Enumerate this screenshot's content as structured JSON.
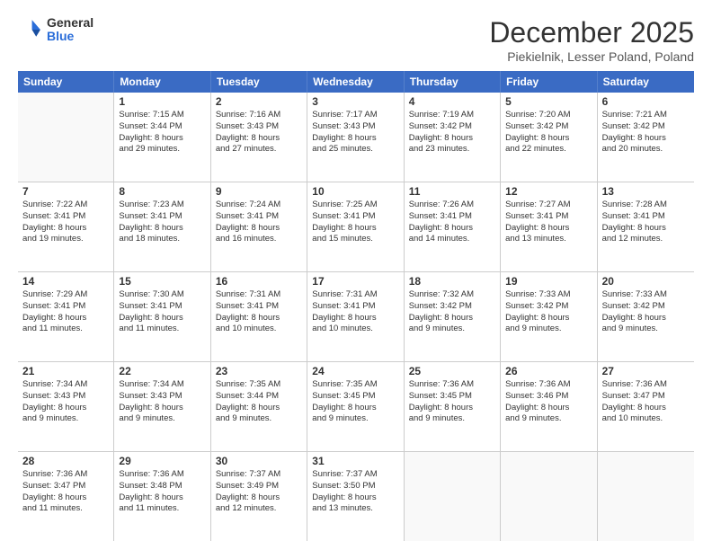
{
  "header": {
    "logo_general": "General",
    "logo_blue": "Blue",
    "title": "December 2025",
    "location": "Piekielnik, Lesser Poland, Poland"
  },
  "days_of_week": [
    "Sunday",
    "Monday",
    "Tuesday",
    "Wednesday",
    "Thursday",
    "Friday",
    "Saturday"
  ],
  "weeks": [
    [
      {
        "day": "",
        "empty": true
      },
      {
        "day": "1",
        "sunrise": "Sunrise: 7:15 AM",
        "sunset": "Sunset: 3:44 PM",
        "daylight": "Daylight: 8 hours",
        "daylight2": "and 29 minutes."
      },
      {
        "day": "2",
        "sunrise": "Sunrise: 7:16 AM",
        "sunset": "Sunset: 3:43 PM",
        "daylight": "Daylight: 8 hours",
        "daylight2": "and 27 minutes."
      },
      {
        "day": "3",
        "sunrise": "Sunrise: 7:17 AM",
        "sunset": "Sunset: 3:43 PM",
        "daylight": "Daylight: 8 hours",
        "daylight2": "and 25 minutes."
      },
      {
        "day": "4",
        "sunrise": "Sunrise: 7:19 AM",
        "sunset": "Sunset: 3:42 PM",
        "daylight": "Daylight: 8 hours",
        "daylight2": "and 23 minutes."
      },
      {
        "day": "5",
        "sunrise": "Sunrise: 7:20 AM",
        "sunset": "Sunset: 3:42 PM",
        "daylight": "Daylight: 8 hours",
        "daylight2": "and 22 minutes."
      },
      {
        "day": "6",
        "sunrise": "Sunrise: 7:21 AM",
        "sunset": "Sunset: 3:42 PM",
        "daylight": "Daylight: 8 hours",
        "daylight2": "and 20 minutes."
      }
    ],
    [
      {
        "day": "7",
        "sunrise": "Sunrise: 7:22 AM",
        "sunset": "Sunset: 3:41 PM",
        "daylight": "Daylight: 8 hours",
        "daylight2": "and 19 minutes."
      },
      {
        "day": "8",
        "sunrise": "Sunrise: 7:23 AM",
        "sunset": "Sunset: 3:41 PM",
        "daylight": "Daylight: 8 hours",
        "daylight2": "and 18 minutes."
      },
      {
        "day": "9",
        "sunrise": "Sunrise: 7:24 AM",
        "sunset": "Sunset: 3:41 PM",
        "daylight": "Daylight: 8 hours",
        "daylight2": "and 16 minutes."
      },
      {
        "day": "10",
        "sunrise": "Sunrise: 7:25 AM",
        "sunset": "Sunset: 3:41 PM",
        "daylight": "Daylight: 8 hours",
        "daylight2": "and 15 minutes."
      },
      {
        "day": "11",
        "sunrise": "Sunrise: 7:26 AM",
        "sunset": "Sunset: 3:41 PM",
        "daylight": "Daylight: 8 hours",
        "daylight2": "and 14 minutes."
      },
      {
        "day": "12",
        "sunrise": "Sunrise: 7:27 AM",
        "sunset": "Sunset: 3:41 PM",
        "daylight": "Daylight: 8 hours",
        "daylight2": "and 13 minutes."
      },
      {
        "day": "13",
        "sunrise": "Sunrise: 7:28 AM",
        "sunset": "Sunset: 3:41 PM",
        "daylight": "Daylight: 8 hours",
        "daylight2": "and 12 minutes."
      }
    ],
    [
      {
        "day": "14",
        "sunrise": "Sunrise: 7:29 AM",
        "sunset": "Sunset: 3:41 PM",
        "daylight": "Daylight: 8 hours",
        "daylight2": "and 11 minutes."
      },
      {
        "day": "15",
        "sunrise": "Sunrise: 7:30 AM",
        "sunset": "Sunset: 3:41 PM",
        "daylight": "Daylight: 8 hours",
        "daylight2": "and 11 minutes."
      },
      {
        "day": "16",
        "sunrise": "Sunrise: 7:31 AM",
        "sunset": "Sunset: 3:41 PM",
        "daylight": "Daylight: 8 hours",
        "daylight2": "and 10 minutes."
      },
      {
        "day": "17",
        "sunrise": "Sunrise: 7:31 AM",
        "sunset": "Sunset: 3:41 PM",
        "daylight": "Daylight: 8 hours",
        "daylight2": "and 10 minutes."
      },
      {
        "day": "18",
        "sunrise": "Sunrise: 7:32 AM",
        "sunset": "Sunset: 3:42 PM",
        "daylight": "Daylight: 8 hours",
        "daylight2": "and 9 minutes."
      },
      {
        "day": "19",
        "sunrise": "Sunrise: 7:33 AM",
        "sunset": "Sunset: 3:42 PM",
        "daylight": "Daylight: 8 hours",
        "daylight2": "and 9 minutes."
      },
      {
        "day": "20",
        "sunrise": "Sunrise: 7:33 AM",
        "sunset": "Sunset: 3:42 PM",
        "daylight": "Daylight: 8 hours",
        "daylight2": "and 9 minutes."
      }
    ],
    [
      {
        "day": "21",
        "sunrise": "Sunrise: 7:34 AM",
        "sunset": "Sunset: 3:43 PM",
        "daylight": "Daylight: 8 hours",
        "daylight2": "and 9 minutes."
      },
      {
        "day": "22",
        "sunrise": "Sunrise: 7:34 AM",
        "sunset": "Sunset: 3:43 PM",
        "daylight": "Daylight: 8 hours",
        "daylight2": "and 9 minutes."
      },
      {
        "day": "23",
        "sunrise": "Sunrise: 7:35 AM",
        "sunset": "Sunset: 3:44 PM",
        "daylight": "Daylight: 8 hours",
        "daylight2": "and 9 minutes."
      },
      {
        "day": "24",
        "sunrise": "Sunrise: 7:35 AM",
        "sunset": "Sunset: 3:45 PM",
        "daylight": "Daylight: 8 hours",
        "daylight2": "and 9 minutes."
      },
      {
        "day": "25",
        "sunrise": "Sunrise: 7:36 AM",
        "sunset": "Sunset: 3:45 PM",
        "daylight": "Daylight: 8 hours",
        "daylight2": "and 9 minutes."
      },
      {
        "day": "26",
        "sunrise": "Sunrise: 7:36 AM",
        "sunset": "Sunset: 3:46 PM",
        "daylight": "Daylight: 8 hours",
        "daylight2": "and 9 minutes."
      },
      {
        "day": "27",
        "sunrise": "Sunrise: 7:36 AM",
        "sunset": "Sunset: 3:47 PM",
        "daylight": "Daylight: 8 hours",
        "daylight2": "and 10 minutes."
      }
    ],
    [
      {
        "day": "28",
        "sunrise": "Sunrise: 7:36 AM",
        "sunset": "Sunset: 3:47 PM",
        "daylight": "Daylight: 8 hours",
        "daylight2": "and 11 minutes."
      },
      {
        "day": "29",
        "sunrise": "Sunrise: 7:36 AM",
        "sunset": "Sunset: 3:48 PM",
        "daylight": "Daylight: 8 hours",
        "daylight2": "and 11 minutes."
      },
      {
        "day": "30",
        "sunrise": "Sunrise: 7:37 AM",
        "sunset": "Sunset: 3:49 PM",
        "daylight": "Daylight: 8 hours",
        "daylight2": "and 12 minutes."
      },
      {
        "day": "31",
        "sunrise": "Sunrise: 7:37 AM",
        "sunset": "Sunset: 3:50 PM",
        "daylight": "Daylight: 8 hours",
        "daylight2": "and 13 minutes."
      },
      {
        "day": "",
        "empty": true
      },
      {
        "day": "",
        "empty": true
      },
      {
        "day": "",
        "empty": true
      }
    ]
  ]
}
